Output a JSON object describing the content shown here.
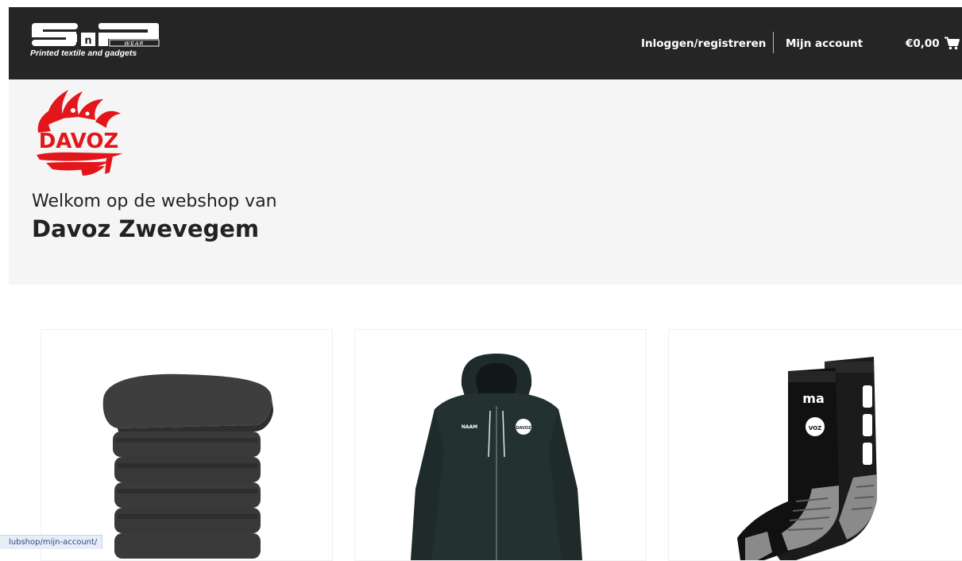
{
  "header": {
    "logo_tagline": "Printed textile and gadgets",
    "logo_wear": "WEAR",
    "logo_n": "n",
    "nav_login": "Inloggen/registreren",
    "nav_account": "Mijn account",
    "cart_total": "€0,00",
    "cart_icon": "cart-icon"
  },
  "hero": {
    "club_logo_text": "DAVOZ",
    "welcome": "Welkom op de webshop van",
    "club_name": "Davoz Zwevegem"
  },
  "products": [
    {
      "image": "towel-stack"
    },
    {
      "image": "hoodie",
      "chest_label": "NAAM",
      "badge": "DAVOZ"
    },
    {
      "image": "socks",
      "brand": "ma",
      "badge": "VOZ"
    }
  ],
  "status_bar": {
    "url": "lubshop/mijn-account/"
  },
  "colors": {
    "header_bg": "#252525",
    "hero_bg": "#f5f5f5",
    "club_red": "#e3161b"
  }
}
